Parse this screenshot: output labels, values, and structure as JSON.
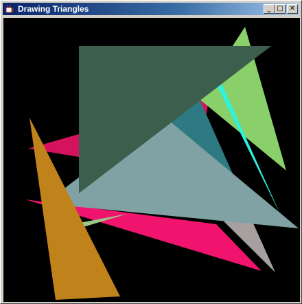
{
  "window": {
    "title": "Drawing Triangles",
    "icon": "java-coffee-cup-icon",
    "buttons": {
      "minimize": "_",
      "maximize": "□",
      "close": "✕"
    }
  },
  "canvas": {
    "background": "#000000",
    "triangle_colors": [
      "#d4125e",
      "#2e7a82",
      "#8ad06a",
      "#2ef2e0",
      "#a6a0a0",
      "#f0146e",
      "#80a2a4",
      "#3c5e4c",
      "#c0821a",
      "#9cc88a"
    ]
  }
}
